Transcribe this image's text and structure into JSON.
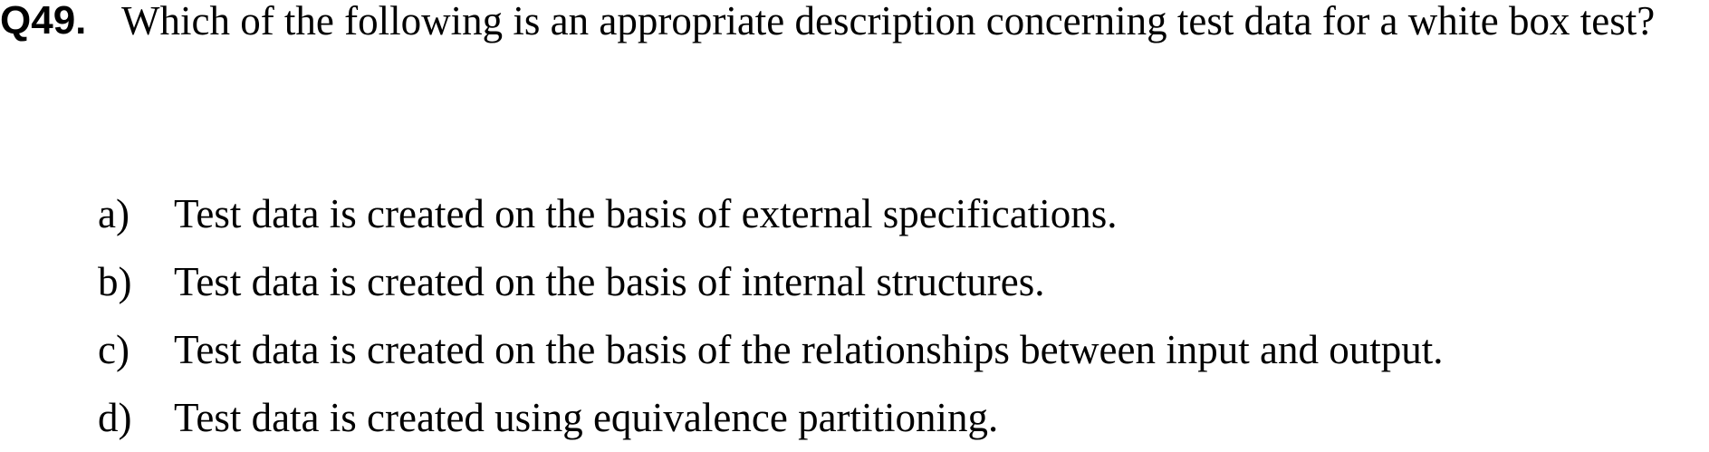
{
  "question": {
    "number": "Q49.",
    "text": "Which of the following is an appropriate description concerning test data for a white box test?"
  },
  "options": [
    {
      "letter": "a)",
      "text": "Test data is created on the basis of external specifications."
    },
    {
      "letter": "b)",
      "text": "Test data is created on the basis of internal structures."
    },
    {
      "letter": "c)",
      "text": "Test data is created on the basis of the relationships between input and output."
    },
    {
      "letter": "d)",
      "text": "Test data is created using equivalence partitioning."
    }
  ]
}
